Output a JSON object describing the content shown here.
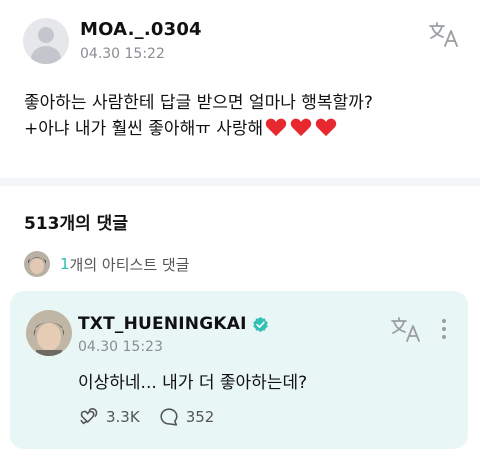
{
  "post": {
    "author": "MOA._.0304",
    "time": "04.30 15:22",
    "line1": "좋아하는 사람한테 답글 받으면 얼마나 행복할까?",
    "line2": "+아냐 내가 훨씬 좋아해ㅠ 사랑해",
    "emoji": [
      "red-heart",
      "red-heart",
      "red-heart"
    ]
  },
  "comments": {
    "count_label": "513개의 댓글",
    "artist_count": "1",
    "artist_label": "개의 아티스트 댓글"
  },
  "reply": {
    "author": "TXT_HUENINGKAI",
    "time": "04.30 15:23",
    "text": "이상하네... 내가 더 좋아하는데?",
    "likes": "3.3K",
    "replies": "352"
  },
  "colors": {
    "accent": "#2fbdb3",
    "reply_bg": "#e8f7f5",
    "verified": "#35c0b6",
    "heart": "#e8282f"
  },
  "icons": [
    "translate-icon",
    "verified-icon",
    "more-icon",
    "like-icon",
    "comment-icon"
  ]
}
